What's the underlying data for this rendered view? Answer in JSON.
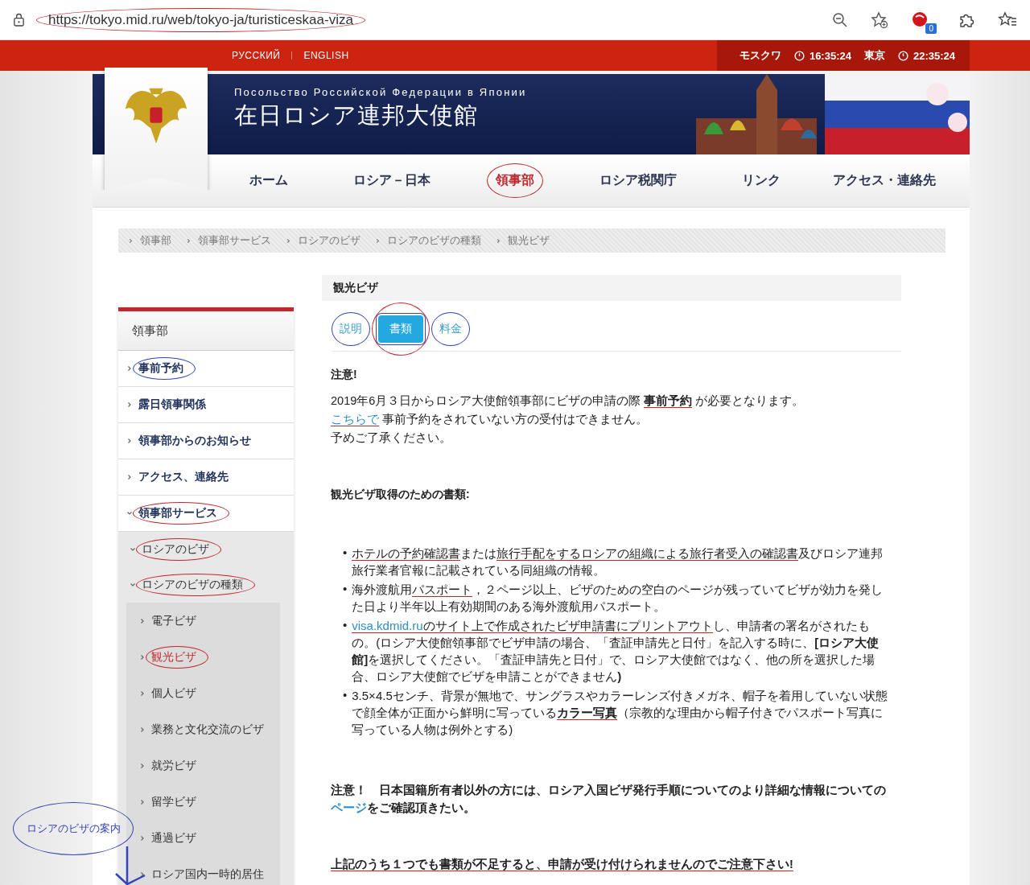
{
  "browser": {
    "url": "https://tokyo.mid.ru/web/tokyo-ja/turisticeskaa-viza",
    "url_circled": true,
    "extension_badge": "0"
  },
  "topbar": {
    "languages": [
      "РУССКИЙ",
      "ENGLISH"
    ],
    "clocks": [
      {
        "city": "モスクワ",
        "time": "16:35:24"
      },
      {
        "city": "東京",
        "time": "22:35:24"
      }
    ]
  },
  "header": {
    "subtitle": "Посольство Российской Федерации в Японии",
    "title": "在日ロシア連邦大使館"
  },
  "nav": [
    {
      "label": "ホーム",
      "selected": false,
      "circled": false
    },
    {
      "label": "ロシア－日本",
      "selected": false,
      "circled": false
    },
    {
      "label": "領事部",
      "selected": true,
      "circled": true,
      "color": "#c0282d"
    },
    {
      "label": "ロシア税関庁",
      "selected": false,
      "circled": false
    },
    {
      "label": "リンク",
      "selected": false,
      "circled": false
    },
    {
      "label": "アクセス・連絡先",
      "selected": false,
      "circled": false
    }
  ],
  "breadcrumb": [
    "領事部",
    "領事部サービス",
    "ロシアのビザ",
    "ロシアのビザの種類",
    "観光ビザ"
  ],
  "sidebar": {
    "heading": "領事部",
    "items": [
      {
        "label": "事前予約",
        "selected": false,
        "expanded": false,
        "circled": true,
        "color": "#3345b8"
      },
      {
        "label": "露日領事関係",
        "selected": false,
        "expanded": false,
        "circled": false
      },
      {
        "label": "領事部からのお知らせ",
        "selected": false,
        "expanded": false,
        "circled": false
      },
      {
        "label": "アクセス、連絡先",
        "selected": false,
        "expanded": false,
        "circled": false
      },
      {
        "label": "領事部サービス",
        "selected": false,
        "expanded": true,
        "circled": true,
        "color": "#c0282d",
        "children": [
          {
            "label": "ロシアのビザ",
            "selected": false,
            "expanded": true,
            "circled": true,
            "color": "#c0282d",
            "children": [
              {
                "label": "ロシアのビザの種類",
                "selected": false,
                "expanded": true,
                "circled": true,
                "color": "#c0282d",
                "children": [
                  {
                    "label": "電子ビザ",
                    "selected": false,
                    "expanded": false,
                    "circled": false
                  },
                  {
                    "label": "観光ビザ",
                    "selected": true,
                    "expanded": false,
                    "circled": true,
                    "color": "#c0282d"
                  },
                  {
                    "label": "個人ビザ",
                    "selected": false,
                    "expanded": false,
                    "circled": false
                  },
                  {
                    "label": "業務と文化交流のビザ",
                    "selected": false,
                    "expanded": false,
                    "circled": false
                  },
                  {
                    "label": "就労ビザ",
                    "selected": false,
                    "expanded": false,
                    "circled": false
                  },
                  {
                    "label": "留学ビザ",
                    "selected": false,
                    "expanded": false,
                    "circled": false
                  },
                  {
                    "label": "通過ビザ",
                    "selected": false,
                    "expanded": false,
                    "circled": false
                  },
                  {
                    "label": "ロシア国内一時的居住",
                    "selected": false,
                    "expanded": false,
                    "circled": false
                  }
                ]
              }
            ]
          }
        ]
      }
    ]
  },
  "page_title": "観光ビザ",
  "tabs": [
    {
      "label": "説明",
      "selected": false,
      "circled": true,
      "color": "#3345b8"
    },
    {
      "label": "書類",
      "selected": true,
      "circled": true,
      "color": "#c0282d"
    },
    {
      "label": "料金",
      "selected": false,
      "circled": true,
      "color": "#3345b8"
    }
  ],
  "notice": {
    "heading": "注意!",
    "lines": [
      [
        {
          "text": "2019年6月３日からロシア大使館領事部にビザの申請の際 ",
          "kind": "text",
          "underlined": false
        },
        {
          "text": "事前予約",
          "kind": "bold",
          "underlined": true
        },
        {
          "text": " が必要となります。",
          "kind": "text",
          "underlined": false
        }
      ],
      [
        {
          "text": "こちらで",
          "kind": "link",
          "underlined": true
        },
        {
          "text": " 事前予約をされていない方の受付はできません。",
          "kind": "text",
          "underlined": false
        }
      ],
      [
        {
          "text": "予めご了承ください。",
          "kind": "text",
          "underlined": false
        }
      ]
    ]
  },
  "documents": {
    "heading": "観光ビザ取得のための書類:",
    "bullets": [
      {
        "marker": "•",
        "segments": [
          {
            "text": "ホテルの予約確認書",
            "kind": "text",
            "underlined": true
          },
          {
            "text": "または",
            "kind": "text",
            "underlined": false
          },
          {
            "text": "旅行手配をするロシアの組織による旅行者受入の確認書",
            "kind": "text",
            "underlined": true
          },
          {
            "text": "及びロシア連邦旅行業者官報に記載されている同組織の情報。",
            "kind": "text",
            "underlined": false
          }
        ]
      },
      {
        "marker": "•",
        "segments": [
          {
            "text": "海外渡航用",
            "kind": "text",
            "underlined": false
          },
          {
            "text": "パスポート",
            "kind": "text",
            "underlined": true
          },
          {
            "text": "，２ページ以上、ビザのための空白のページが残っていてビザが効力を発した日より半年以上有効期間のある海外渡航用パスポート。",
            "kind": "text",
            "underlined": false
          }
        ]
      },
      {
        "marker": "•",
        "segments": [
          {
            "text": "visa.kdmid.ru",
            "kind": "link",
            "underlined": true
          },
          {
            "text": "のサイト上で作成されたビザ申請書にプリントアウト",
            "kind": "text",
            "underlined": true
          },
          {
            "text": "し、申請者の署名がされたもの。(ロシア大使館領事部でビザ申請の場合、「査証申請先と日付」を記入する時に、",
            "kind": "text",
            "underlined": false
          },
          {
            "text": "[ロシア大使館]",
            "kind": "bold",
            "underlined": false
          },
          {
            "text": "を選択してください。「査証申請先と日付」で、ロシア大使館ではなく、他の所を選択した場合、ロシア大使館でビザを申請ことができません",
            "kind": "text",
            "underlined": false
          },
          {
            "text": ")",
            "kind": "bold",
            "underlined": false
          }
        ]
      },
      {
        "marker": "•",
        "segments": [
          {
            "text": "3.5×4.5センチ、背景が無地で、サングラスやカラーレンズ付きメガネ、帽子を着用していない状態で顔全体が正面から鮮明に写っている",
            "kind": "text",
            "underlined": false
          },
          {
            "text": "カラー写真",
            "kind": "bold",
            "underlined": true
          },
          {
            "text": "（宗教的な理由から帽子付きでパスポート写真に写っている人物は例外とする)",
            "kind": "text",
            "underlined": false
          }
        ]
      }
    ]
  },
  "note": [
    {
      "text": "注意！　日本国籍所有者以外の方には、ロシア入国ビザ発行手順についてのより詳細な情報についての",
      "kind": "bold",
      "underlined": false
    },
    {
      "text": "ページ",
      "kind": "link",
      "underlined": false
    },
    {
      "text": "をご確認頂きたい。",
      "kind": "bold",
      "underlined": false
    }
  ],
  "warning": [
    {
      "text": "上記のうち１つでも書類が不足すると、申請が受け付けられませんのでご注意下さい!",
      "kind": "bold",
      "underlined": true
    }
  ],
  "annotation_note": {
    "text": "ロシアのビザの案内"
  }
}
